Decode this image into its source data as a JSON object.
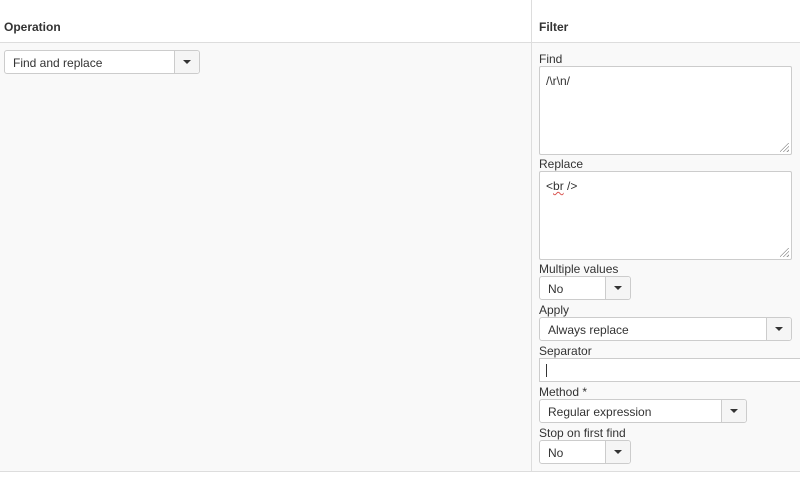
{
  "header": {
    "operation_label": "Operation",
    "filter_label": "Filter"
  },
  "operation": {
    "selected": "Find and replace"
  },
  "filter": {
    "find": {
      "label": "Find",
      "value": "/\\r\\n/"
    },
    "replace": {
      "label": "Replace",
      "value_prefix": "<",
      "value_misspelled": "br",
      "value_suffix": " />"
    },
    "multiple_values": {
      "label": "Multiple values",
      "selected": "No"
    },
    "apply": {
      "label": "Apply",
      "selected": "Always replace"
    },
    "separator": {
      "label": "Separator",
      "value": ""
    },
    "method": {
      "label": "Method *",
      "selected": "Regular expression"
    },
    "stop_on_first_find": {
      "label": "Stop on first find",
      "selected": "No"
    }
  }
}
